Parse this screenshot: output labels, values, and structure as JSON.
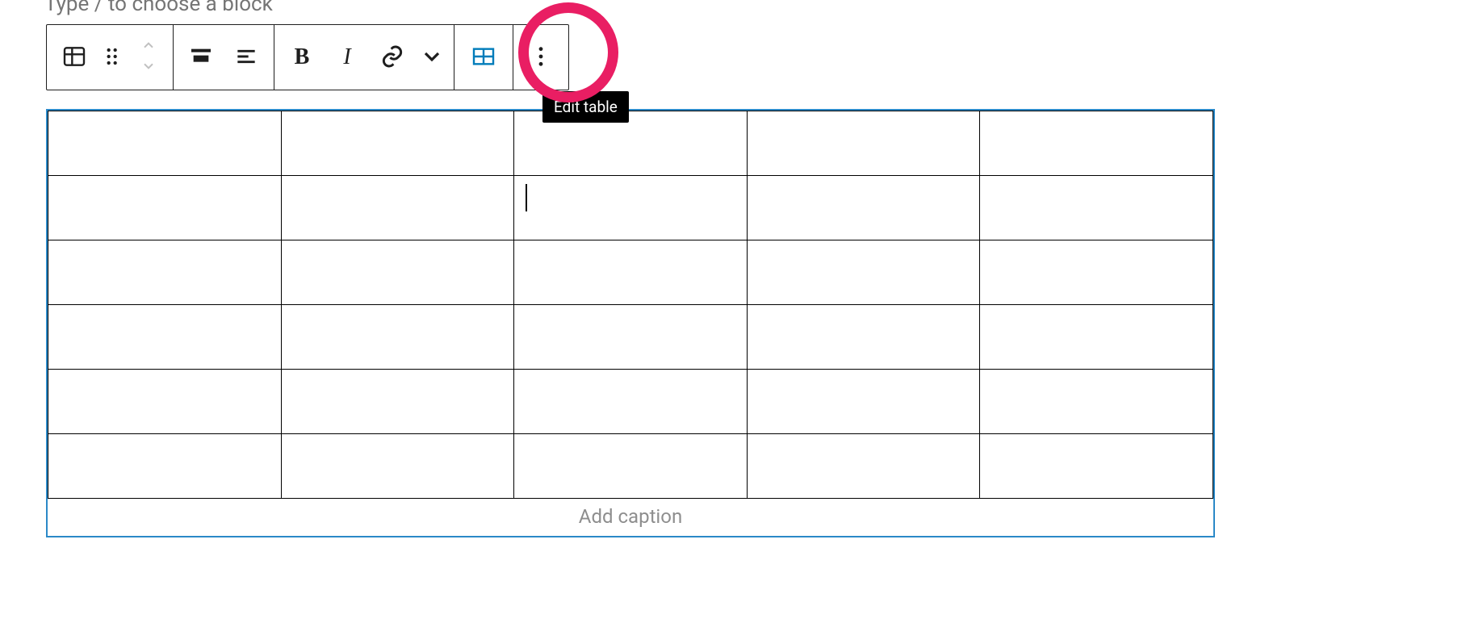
{
  "hint": "Type / to choose a block",
  "toolbar": {
    "groups": [
      {
        "name": "block",
        "items": [
          {
            "id": "table-block-icon",
            "icon": "table",
            "interactable": true
          },
          {
            "id": "drag-handle",
            "icon": "drag",
            "interactable": true
          },
          {
            "id": "move-up-down",
            "icon": "movers",
            "interactable": true
          }
        ]
      },
      {
        "name": "align",
        "items": [
          {
            "id": "align-button",
            "icon": "align-center",
            "interactable": true
          },
          {
            "id": "align-text-button",
            "icon": "align-left-text",
            "interactable": true
          }
        ]
      },
      {
        "name": "format",
        "items": [
          {
            "id": "bold-button",
            "icon": "bold",
            "interactable": true
          },
          {
            "id": "italic-button",
            "icon": "italic",
            "interactable": true
          },
          {
            "id": "link-button",
            "icon": "link",
            "interactable": true
          },
          {
            "id": "more-format-button",
            "icon": "chevron-down",
            "interactable": true
          }
        ]
      },
      {
        "name": "table-edit",
        "items": [
          {
            "id": "edit-table-button",
            "icon": "table-outline",
            "interactable": true,
            "active": true,
            "tooltip": "Edit table"
          }
        ]
      },
      {
        "name": "options",
        "items": [
          {
            "id": "options-button",
            "icon": "dots",
            "interactable": true
          }
        ]
      }
    ]
  },
  "tooltip_text": "Edit table",
  "table": {
    "rows": 6,
    "cols": 5,
    "active_cell": {
      "row": 1,
      "col": 2
    },
    "data": [
      [
        "",
        "",
        "",
        "",
        ""
      ],
      [
        "",
        "",
        "",
        "",
        ""
      ],
      [
        "",
        "",
        "",
        "",
        ""
      ],
      [
        "",
        "",
        "",
        "",
        ""
      ],
      [
        "",
        "",
        "",
        "",
        ""
      ],
      [
        "",
        "",
        "",
        "",
        ""
      ]
    ]
  },
  "caption_placeholder": "Add caption",
  "colors": {
    "accent": "#007cba",
    "highlight": "#e91e63",
    "selection_border": "#2b89c8"
  }
}
